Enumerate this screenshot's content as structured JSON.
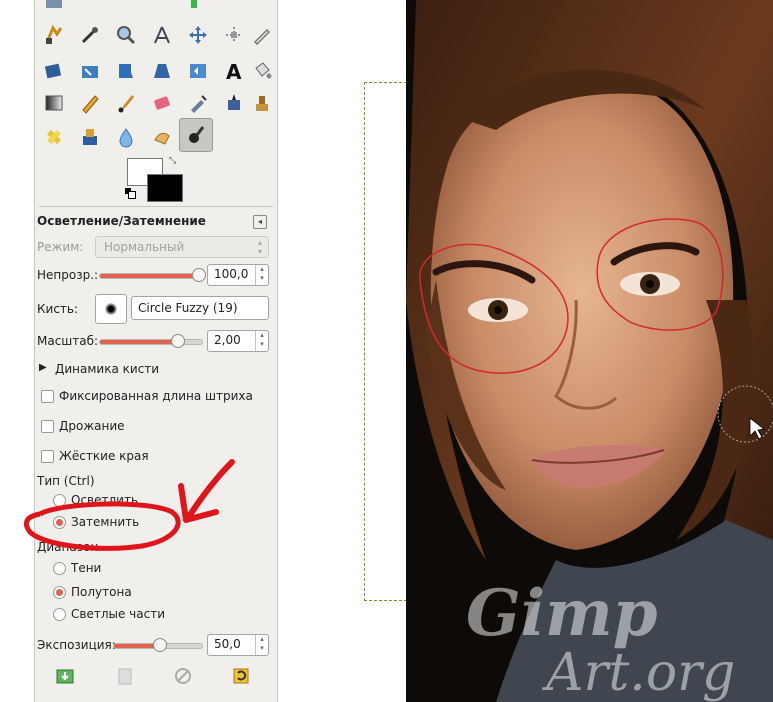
{
  "tool_options": {
    "title": "Осветление/Затемнение",
    "mode_label": "Режим:",
    "mode_value": "Нормальный",
    "opacity_label": "Непрозр.:",
    "opacity_value": "100,0",
    "opacity_fraction": 1.0,
    "brush_label": "Кисть:",
    "brush_value": "Circle Fuzzy (19)",
    "scale_label": "Масштаб:",
    "scale_value": "2,00",
    "scale_fraction": 0.77,
    "dynamics_label": "Динамика кисти",
    "fixed_length_label": "Фиксированная длина штриха",
    "jitter_label": "Дрожание",
    "hard_edge_label": "Жёсткие края",
    "type_label": "Тип  (Ctrl)",
    "type_options": [
      "Осветлить",
      "Затемнить"
    ],
    "type_selected": "Затемнить",
    "range_label": "Диапазон",
    "range_options": [
      "Тени",
      "Полутона",
      "Светлые части"
    ],
    "range_selected": "Полутона",
    "exposure_label": "Экспозиция:",
    "exposure_value": "50,0",
    "exposure_fraction": 0.5
  },
  "watermark": {
    "line1": "Gimp",
    "line2": "Art.org"
  },
  "colors": {
    "accent": "#e0614d",
    "annotation": "#e0141b",
    "fg": "#000000",
    "bg": "#ffffff"
  }
}
